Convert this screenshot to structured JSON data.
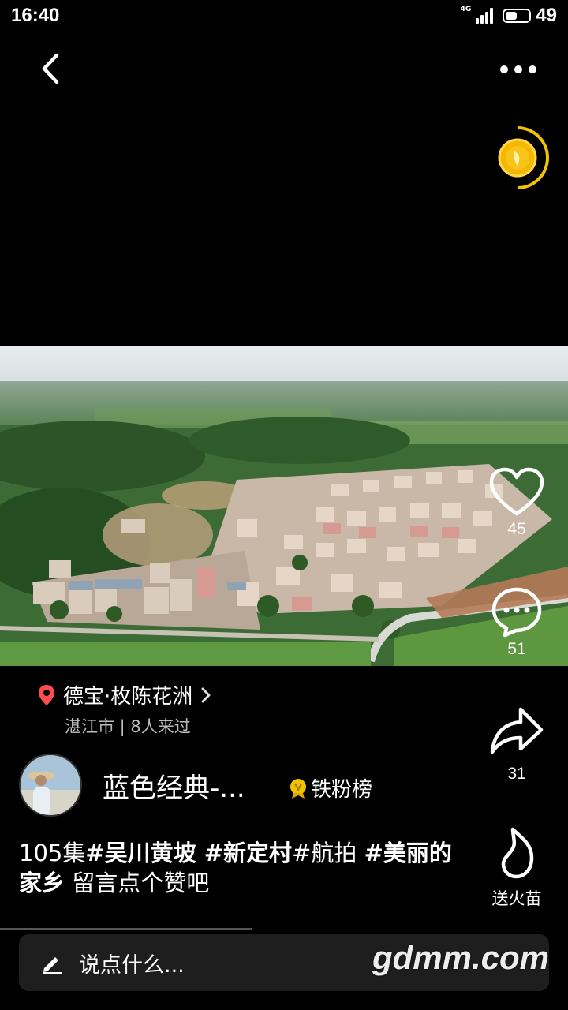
{
  "status_bar": {
    "time": "16:40",
    "network": "4G",
    "battery": "49"
  },
  "header": {
    "back_icon": "chevron-left-icon",
    "more_icon": "ellipsis-icon"
  },
  "coin_widget": {
    "icon": "gold-coin-icon",
    "accent": "#f2c300"
  },
  "video": {
    "subject": "aerial-village-photo"
  },
  "actions": {
    "like": {
      "count": "45",
      "icon": "heart-icon"
    },
    "comment": {
      "count": "51",
      "icon": "comment-bubble-icon"
    },
    "share": {
      "count": "31",
      "icon": "share-arrow-icon"
    },
    "gift": {
      "label": "送火苗",
      "icon": "flame-icon"
    }
  },
  "location": {
    "name": "德宝·枚陈花洲",
    "sub": "湛江市 | 8人来过",
    "pin_color": "#ff4d4f"
  },
  "author": {
    "name": "蓝色经典-...",
    "fan_rank_label": "铁粉榜"
  },
  "caption": {
    "parts": [
      {
        "text": "105集",
        "bold": false
      },
      {
        "text": "#吴川黄坡 #新定村",
        "bold": true
      },
      {
        "text": "#航拍 ",
        "bold": false
      },
      {
        "text": "#美丽的家乡",
        "bold": true
      },
      {
        "text": " 留言点个赞吧",
        "bold": false
      }
    ]
  },
  "comment_bar": {
    "placeholder": "说点什么...",
    "icon": "pencil-icon"
  },
  "watermark": "gdmm.com"
}
